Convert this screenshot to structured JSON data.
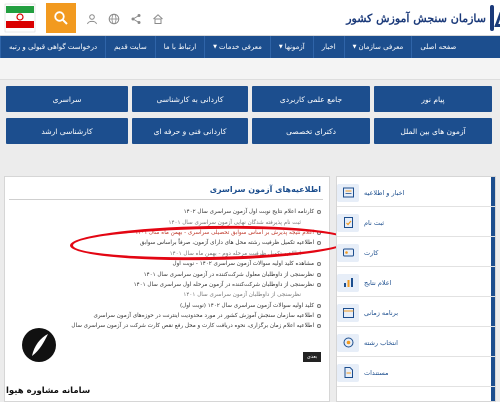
{
  "header": {
    "site_name": "سازمان سنجش آموزش کشور",
    "icons": [
      "home-icon",
      "share-icon",
      "globe-icon",
      "user-icon"
    ]
  },
  "nav": {
    "items": [
      {
        "label": "صفحه اصلی",
        "caret": false
      },
      {
        "label": "معرفی سازمان",
        "caret": true
      },
      {
        "label": "اخبار",
        "caret": false
      },
      {
        "label": "آزمونها",
        "caret": true
      },
      {
        "label": "معرفی خدمات",
        "caret": true
      },
      {
        "label": "ارتباط با ما",
        "caret": false
      },
      {
        "label": "سایت قدیم",
        "caret": false
      },
      {
        "label": "درخواست گواهی قبولی و رتبه",
        "caret": false
      }
    ]
  },
  "tiles": [
    {
      "label": "پیام نور"
    },
    {
      "label": "جامع علمی کاربردی"
    },
    {
      "label": "کاردانی به کارشناسی"
    },
    {
      "label": "سراسری"
    },
    {
      "label": "آزمون های بین الملل"
    },
    {
      "label": "دکترای تخصصی"
    },
    {
      "label": "کاردانی فنی و حرفه ای"
    },
    {
      "label": "کارشناسی ارشد"
    }
  ],
  "news_panel": {
    "title": "اطلاعیه‌های آزمون سراسری",
    "items": [
      {
        "text": "کارنامه اعلام نتایج نوبت اول آزمون سراسری سال ۱۴۰۲",
        "kind": "normal"
      },
      {
        "text": "ثبت نام پذیرفته شدگان نهایی آزمون سراسری سال ۱۴۰۱",
        "kind": "sub"
      },
      {
        "text": "اعلام نتیجه پذیرش بر اساس سوابق تحصیلی سراسری - بهمن ماه سال ۱۴۰۱",
        "kind": "hl"
      },
      {
        "text": "اطلاعیه تکمیل ظرفیت رشته محل های دارای آزمون، صرفاً براساس سوابق",
        "kind": "normal"
      },
      {
        "text": "اطلاعیه تکمیل ظرفیت مرحله دوم - بهمن ماه سال ۱۴۰۱",
        "kind": "sub"
      },
      {
        "text": "مشاهده کلید اولیه سوالات آزمون سراسری ۱۴۰۲ - نوبت اول",
        "kind": "normal"
      },
      {
        "text": "نظرسنجی از داوطلبان معلول شرکت‌کننده در آزمون سراسری سال ۱۴۰۱",
        "kind": "normal"
      },
      {
        "text": "نظرسنجی از داوطلبان شرکت‌کننده در آزمون مرحله اول سراسری سال ۱۴۰۱",
        "kind": "normal"
      },
      {
        "text": "نظرسنجی از داوطلبان آزمون سراسری سال ۱۴۰۱",
        "kind": "sub"
      },
      {
        "text": "کلید اولیه سوالات آزمون سراسری سال ۱۴۰۲ (نوبت اول)",
        "kind": "normal"
      },
      {
        "text": "اطلاعیه سازمان سنجش آموزش کشور در مورد محدودیت اینترنت در حوزه‌های آزمون سراسری",
        "kind": "normal"
      },
      {
        "text": "اطلاعیه اعلام زمان برگزاری، نحوه دریافت کارت و محل رفع نقص کارت شرکت در آزمون سراسری سال",
        "kind": "normal"
      }
    ],
    "more_label": "بعدی"
  },
  "sidebar": {
    "items": [
      {
        "label": "اخبار و اطلاعیه",
        "icon": "news-icon"
      },
      {
        "label": "ثبت نام",
        "icon": "register-icon"
      },
      {
        "label": "کارت",
        "icon": "card-icon"
      },
      {
        "label": "اعلام نتایج",
        "icon": "results-icon"
      },
      {
        "label": "برنامه زمانی",
        "icon": "calendar-icon"
      },
      {
        "label": "انتخاب رشته",
        "icon": "choice-icon"
      },
      {
        "label": "مستندات",
        "icon": "docs-icon"
      }
    ]
  },
  "watermark": {
    "text": "سامانه مشاوره هیوا"
  },
  "colors": {
    "primary": "#1c4e8e",
    "accent": "#f29a1f",
    "highlight": "#e30613"
  }
}
